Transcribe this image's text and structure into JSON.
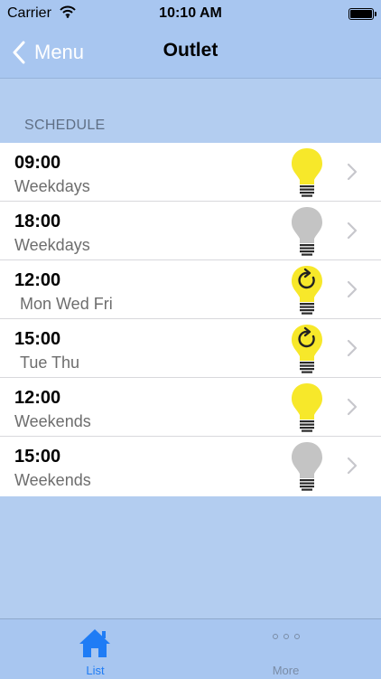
{
  "status": {
    "carrier": "Carrier",
    "time": "10:10 AM"
  },
  "nav": {
    "back_label": "Menu",
    "title": "Outlet"
  },
  "section": {
    "header": "SCHEDULE"
  },
  "schedule": [
    {
      "time": "09:00",
      "days": "Weekdays",
      "bulb": "bulb-on-icon",
      "indent": false
    },
    {
      "time": "18:00",
      "days": "Weekdays",
      "bulb": "bulb-off-icon",
      "indent": false
    },
    {
      "time": "12:00",
      "days": "Mon Wed Fri",
      "bulb": "bulb-toggle-icon",
      "indent": true
    },
    {
      "time": "15:00",
      "days": "Tue Thu",
      "bulb": "bulb-toggle-icon",
      "indent": true
    },
    {
      "time": "12:00",
      "days": "Weekends",
      "bulb": "bulb-on-icon",
      "indent": false
    },
    {
      "time": "15:00",
      "days": "Weekends",
      "bulb": "bulb-off-icon",
      "indent": false
    }
  ],
  "tabs": [
    {
      "label": "List",
      "icon": "home-icon",
      "active": true
    },
    {
      "label": "More",
      "icon": "more-icon",
      "active": false
    }
  ],
  "colors": {
    "bar_background": "#a8c6f0",
    "page_background": "#b3cdf0",
    "bulb_on": "#f7e82a",
    "bulb_off": "#c4c4c4",
    "active_tab": "#1f7cf5"
  }
}
